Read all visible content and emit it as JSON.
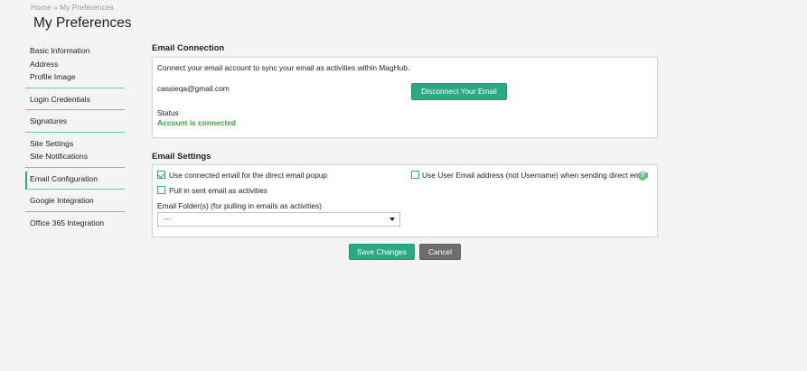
{
  "breadcrumb": {
    "home": "Home",
    "separator": "»",
    "current": "My Preferences"
  },
  "page_title": "My Preferences",
  "sidebar": {
    "groups": [
      [
        "Basic Information",
        "Address",
        "Profile Image"
      ],
      [
        "Login Credentials"
      ],
      [
        "Signatures"
      ],
      [
        "Site Settings",
        "Site Notifications"
      ],
      [
        "Email Configuration"
      ],
      [
        "Google Integration"
      ],
      [
        "Office 365 Integration"
      ]
    ],
    "active": "Email Configuration"
  },
  "email_connection": {
    "title": "Email Connection",
    "description": "Connect your email account to sync your email as activities within MagHub.",
    "email": "cassieqa@gmail.com",
    "disconnect_label": "Disconnect Your Email",
    "status_label": "Status",
    "status_value": "Account is connected"
  },
  "email_settings": {
    "title": "Email Settings",
    "use_connected_email": {
      "label": "Use connected email for the direct email popup",
      "checked": true
    },
    "use_user_email": {
      "label": "Use User Email address (not Username) when sending direct email",
      "checked": false
    },
    "pull_sent_email": {
      "label": "Pull in sent email as activities",
      "checked": false
    },
    "help_icon": "?",
    "folders_label": "Email Folder(s) (for pulling in emails as activities)",
    "folders_value": "---"
  },
  "actions": {
    "save_label": "Save Changes",
    "cancel_label": "Cancel"
  },
  "colors": {
    "accent": "#2ba884",
    "connected": "#3aa23a",
    "cancel": "#6d6d6d"
  }
}
